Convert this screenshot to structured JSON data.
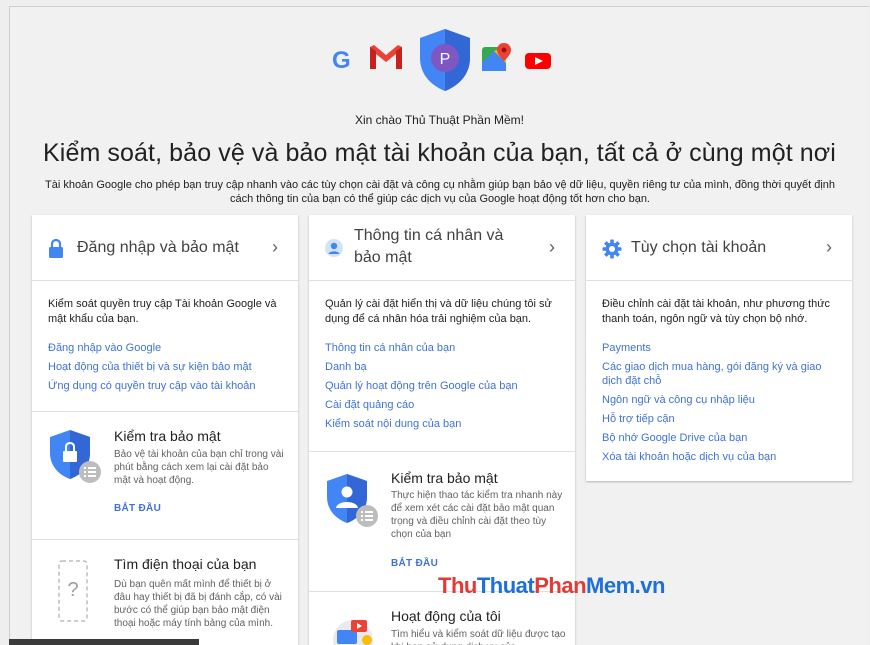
{
  "header": {
    "greeting": "Xin chào Thủ Thuật Phần Mềm!",
    "headline": "Kiểm soát, bảo vệ và bảo mật tài khoản của bạn, tất cả ở cùng một nơi",
    "subtitle": "Tài khoản Google cho phép bạn truy cập nhanh vào các tùy chọn cài đặt và công cụ nhằm giúp bạn bảo vệ dữ liệu, quyền riêng tư của mình, đồng thời quyết định cách thông tin của bạn có thể giúp các dịch vụ của Google hoạt động tốt hơn cho bạn.",
    "avatar_letter": "P",
    "g_letter": "G"
  },
  "cards": {
    "signin": {
      "title": "Đăng nhập và bảo mật",
      "description": "Kiểm soát quyền truy cập Tài khoản Google và mật khẩu của bạn.",
      "links": [
        "Đăng nhập vào Google",
        "Hoạt động của thiết bị và sự kiện bảo mật",
        "Ứng dụng có quyền truy cập vào tài khoản"
      ],
      "promo1": {
        "title": "Kiểm tra bảo mật",
        "text": "Bảo vệ tài khoản của bạn chỉ trong vài phút bằng cách xem lại cài đặt bảo mật và hoạt động.",
        "cta": "BẮT ĐẦU"
      },
      "promo2": {
        "title": "Tìm điện thoại của bạn",
        "text": "Dù bạn quên mất mình để thiết bị ở đâu hay thiết bị đã bị đánh cắp, có vài bước có thể giúp bạn bảo mật điện thoại hoặc máy tính bảng của mình."
      }
    },
    "personal": {
      "title_line1": "Thông tin cá nhân và",
      "title_line2": "bảo mật",
      "description": "Quản lý cài đặt hiển thị và dữ liệu chúng tôi sử dụng để cá nhân hóa trải nghiệm của bạn.",
      "links": [
        "Thông tin cá nhân của bạn",
        "Danh bạ",
        "Quản lý hoạt động trên Google của bạn",
        "Cài đặt quảng cáo",
        "Kiểm soát nội dung của bạn"
      ],
      "promo1": {
        "title": "Kiểm tra bảo mật",
        "text": "Thực hiện thao tác kiểm tra nhanh này để xem xét các cài đặt bảo mật quan trọng và điều chỉnh cài đặt theo tùy chọn của bạn",
        "cta": "BẮT ĐẦU"
      },
      "promo2": {
        "title": "Hoạt động của tôi",
        "text": "Tìm hiểu và kiểm soát dữ liệu được tạo khi bạn sử dụng dịch vụ của"
      }
    },
    "account": {
      "title": "Tùy chọn tài khoản",
      "description": "Điều chỉnh cài đặt tài khoản, như phương thức thanh toán, ngôn ngữ và tùy chọn bộ nhớ.",
      "links": [
        "Payments",
        "Các giao dịch mua hàng, gói đăng ký và giao dịch đặt chỗ",
        "Ngôn ngữ và công cụ nhập liệu",
        "Hỗ trợ tiếp cận",
        "Bộ nhớ Google Drive của bạn",
        "Xóa tài khoản hoặc dịch vụ của bạn"
      ]
    }
  },
  "watermark": {
    "part1": "Thu",
    "part2": "Thuat",
    "part3": "Phan",
    "part4": "Mem.vn"
  },
  "colors": {
    "link": "#3f72d8",
    "shield_blue": "#4285f4",
    "avatar_purple": "#7e57c2",
    "gmail_red": "#ea4335",
    "youtube_red": "#ff0000"
  }
}
